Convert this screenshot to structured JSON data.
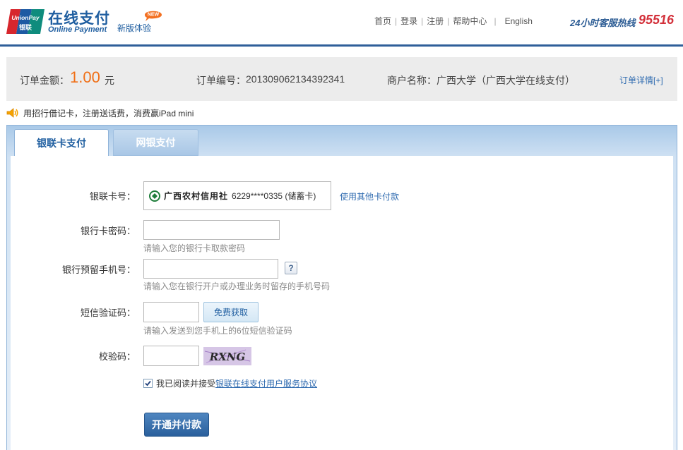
{
  "header": {
    "logo_text_en": "UnionPay",
    "logo_text_cn": "银联",
    "title_cn": "在线支付",
    "title_en": "Online Payment",
    "new_badge": "NEW",
    "new_experience": "新版体验",
    "nav": [
      "首页",
      "登录",
      "注册",
      "帮助中心"
    ],
    "language": "English",
    "hotline_label": "24小时客服热线",
    "hotline_number": "95516"
  },
  "order": {
    "amount_label": "订单金额：",
    "amount": "1.00",
    "currency": "元",
    "order_no_label": "订单编号：",
    "order_no": "201309062134392341",
    "merchant_label": "商户名称：",
    "merchant": "广西大学（广西大学在线支付）",
    "detail_link": "订单详情[+]"
  },
  "promo": {
    "text": "用招行借记卡，注册送话费，消费赢iPad mini"
  },
  "tabs": [
    {
      "label": "银联卡支付",
      "active": true
    },
    {
      "label": "网银支付",
      "active": false
    }
  ],
  "form": {
    "card_label": "银联卡号：",
    "bank_name": "广西农村信用社",
    "card_number": "6229****0335 (储蓄卡)",
    "other_card_link": "使用其他卡付款",
    "password_label": "银行卡密码：",
    "password_hint": "请输入您的银行卡取款密码",
    "phone_label": "银行预留手机号：",
    "phone_help": "?",
    "phone_hint": "请输入您在银行开户或办理业务时留存的手机号码",
    "sms_label": "短信验证码：",
    "sms_button": "免费获取",
    "sms_hint": "请输入发送到您手机上的6位短信验证码",
    "captcha_label": "校验码：",
    "captcha_text": "RXNG",
    "agree_prefix": "我已阅读并接受",
    "agree_link": "银联在线支付用户服务协议",
    "agree_checked": true,
    "submit_button": "开通并付款"
  },
  "colors": {
    "brand_blue": "#1f5ea0",
    "amount_orange": "#f06f16",
    "hotline_red": "#d3313b",
    "link_blue": "#2f6bb0"
  }
}
